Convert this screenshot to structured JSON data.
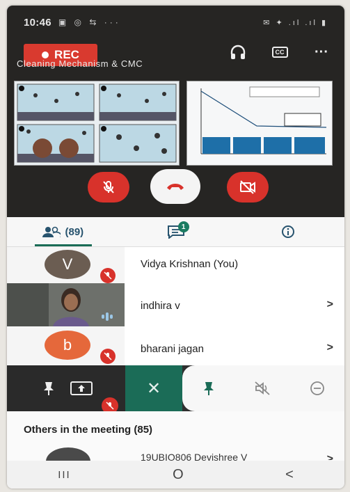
{
  "status_bar": {
    "time": "10:46",
    "left_icons": "▣ ◎ ⇆ ···",
    "right_icons": "✉ ✦ .ıl .ıl ▮"
  },
  "call": {
    "rec_label": "REC",
    "meeting_title": "Cleaning Mechanism & CMC",
    "top_icons": [
      "headphones-icon",
      "captions-icon",
      "more-icon"
    ],
    "cc_label": "CC",
    "more_label": "···"
  },
  "tabs": {
    "people_label": "(89)",
    "chat_badge": "1"
  },
  "participants": [
    {
      "initial": "V",
      "name": "Vidya Krishnan (You)",
      "avatar_color": "#6b5d52",
      "muted": true,
      "has_arrow": false
    },
    {
      "initial": "",
      "name": "indhira v",
      "muted": false,
      "speaking": true,
      "has_arrow": true
    },
    {
      "initial": "b",
      "name": "bharani jagan",
      "avatar_color": "#e5683b",
      "muted": true,
      "has_arrow": true
    }
  ],
  "arrow_label": ">",
  "toolbar": {
    "close_label": "✕"
  },
  "others": {
    "title": "Others in the meeting (85)",
    "partial_name": "19UBIO806 Devishree V"
  },
  "navbar": {
    "recents": "III",
    "home": "O",
    "back": "<"
  },
  "colors": {
    "accent": "#1b6c57",
    "danger": "#d8322b",
    "call_bg": "#262523"
  }
}
